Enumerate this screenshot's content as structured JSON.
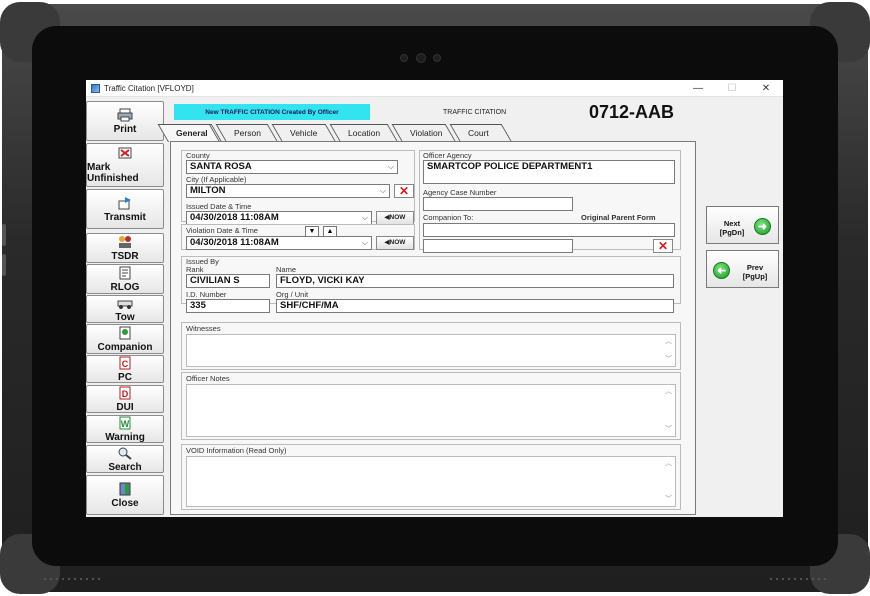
{
  "window": {
    "title": "Traffic Citation [VFLOYD]",
    "minimize": "—",
    "maximize": "☐",
    "close": "✕"
  },
  "toolbar": [
    {
      "label": "Print",
      "icon": "printer-icon"
    },
    {
      "label": "Mark Unfinished",
      "icon": "flag-icon"
    },
    {
      "label": "Transmit",
      "icon": "transmit-icon"
    },
    {
      "label": "TSDR",
      "icon": "people-icon"
    },
    {
      "label": "RLOG",
      "icon": "rlog-icon"
    },
    {
      "label": "Tow",
      "icon": "tow-icon"
    },
    {
      "label": "Companion",
      "icon": "companion-icon"
    },
    {
      "label": "PC",
      "icon": "pc-icon"
    },
    {
      "label": "DUI",
      "icon": "dui-icon"
    },
    {
      "label": "Warning",
      "icon": "warning-icon"
    },
    {
      "label": "Search",
      "icon": "search-icon"
    },
    {
      "label": "Close",
      "icon": "close-door-icon"
    }
  ],
  "header": {
    "banner": "New TRAFFIC CITATION Created By Officer",
    "form_label": "TRAFFIC CITATION",
    "citation_number": "0712-AAB"
  },
  "tabs": [
    "General",
    "Person",
    "Vehicle",
    "Location",
    "Violation",
    "Court"
  ],
  "general": {
    "county_label": "County",
    "county": "SANTA ROSA",
    "city_label": "City (If Applicable)",
    "city": "MILTON",
    "issued_label": "Issued Date & Time",
    "issued": "04/30/2018 11:08AM",
    "violation_label": "Violation Date & Time",
    "violation": "04/30/2018 11:08AM",
    "now_label": "NOW",
    "officer_agency_label": "Officer Agency",
    "officer_agency": "SMARTCOP POLICE DEPARTMENT1",
    "agency_case_label": "Agency Case Number",
    "agency_case": "",
    "companion_label": "Companion To:",
    "parent_form_label": "Original Parent Form",
    "companion": "",
    "parent_form": "",
    "issued_by_label": "Issued By",
    "rank_label": "Rank",
    "rank": "CIVILIAN S",
    "name_label": "Name",
    "name": "FLOYD, VICKI KAY",
    "id_label": "I.D. Number",
    "id": "335",
    "org_label": "Org / Unit",
    "org": "SHF/CHF/MA",
    "witnesses_label": "Witnesses",
    "officer_notes_label": "Officer Notes",
    "void_label": "VOID Information (Read Only)"
  },
  "nav": {
    "next_label": "Next",
    "next_key": "[PgDn]",
    "prev_label": "Prev",
    "prev_key": "[PgUp]"
  }
}
